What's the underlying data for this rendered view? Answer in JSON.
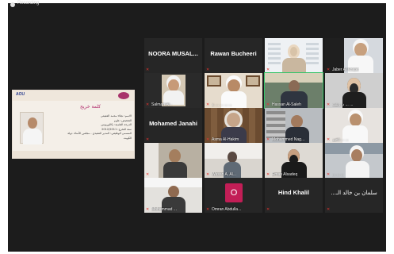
{
  "window": {
    "title": "Recording"
  },
  "shared_screen": {
    "brand": "AOU",
    "heading": "كلمة خريج",
    "lines": [
      "الاسم: نجلاء محمد العفيفي",
      "التخصص: علوم",
      "الدرجة العلمية: بكالوريوس",
      "سنة التخرج: 2012/2011",
      "المسمى الوظيفي: المدير التنفيذي - مجلس الأمناء، دولة الكويت"
    ]
  },
  "participants": [
    {
      "name": "NOORA  MUSAL...",
      "label": "",
      "display": "name"
    },
    {
      "name": "Rawan Bucheeri",
      "label": "",
      "display": "name"
    },
    {
      "name": "",
      "label": "",
      "display": "video"
    },
    {
      "name": "",
      "label": "Jaber Al Khater",
      "display": "video"
    },
    {
      "name": "",
      "label": "Salman Al...",
      "display": "video"
    },
    {
      "name": "",
      "label": "د. ... ... ... ...",
      "display": "video"
    },
    {
      "name": "",
      "label": "Hassan Al-Saleh",
      "display": "video"
    },
    {
      "name": "",
      "label": "د. زينب ... ...",
      "display": "video"
    },
    {
      "name": "Mohamed Janahi",
      "label": "",
      "display": "name"
    },
    {
      "name": "",
      "label": "Asma Al-Hakim",
      "display": "video"
    },
    {
      "name": "",
      "label": "Mohammed Nag...",
      "display": "video"
    },
    {
      "name": "",
      "label": "ناصر ... ...",
      "display": "video"
    },
    {
      "name": "",
      "label": "",
      "display": "video"
    },
    {
      "name": "",
      "label": "Wasan A. Al...",
      "display": "video"
    },
    {
      "name": "",
      "label": "Eman Alsadeq",
      "display": "video"
    },
    {
      "name": "",
      "label": "... ... ...",
      "display": "video"
    },
    {
      "name": "",
      "label": "Mohammad ...",
      "display": "video"
    },
    {
      "name": "",
      "label": "Omran Abdulla...",
      "display": "avatar",
      "initial": "O"
    },
    {
      "name": "Hind Khalil",
      "label": "",
      "display": "name"
    },
    {
      "name": "...سلمان بن خالد الـ",
      "label": "",
      "display": "name"
    }
  ]
}
